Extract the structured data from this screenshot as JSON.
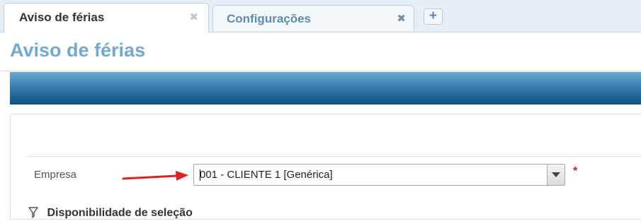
{
  "tabs": [
    {
      "label": "Aviso de férias",
      "active": true,
      "close_icon": "close-icon"
    },
    {
      "label": "Configurações",
      "active": false,
      "close_icon": "close-icon"
    }
  ],
  "add_tab": {
    "icon": "plus-icon",
    "label": "+"
  },
  "page": {
    "title": "Aviso de férias"
  },
  "form": {
    "empresa": {
      "label": "Empresa",
      "value": "001 - CLIENTE 1 [Genérica]",
      "required_mark": "*"
    }
  },
  "section": {
    "title": "Disponibilidade de seleção",
    "icon": "filter-icon"
  },
  "colors": {
    "title": "#73a9d0",
    "band_top": "#6fa9cf",
    "band_bottom": "#124f7c",
    "required": "#d61f1f",
    "annotation_arrow": "#e02020"
  }
}
